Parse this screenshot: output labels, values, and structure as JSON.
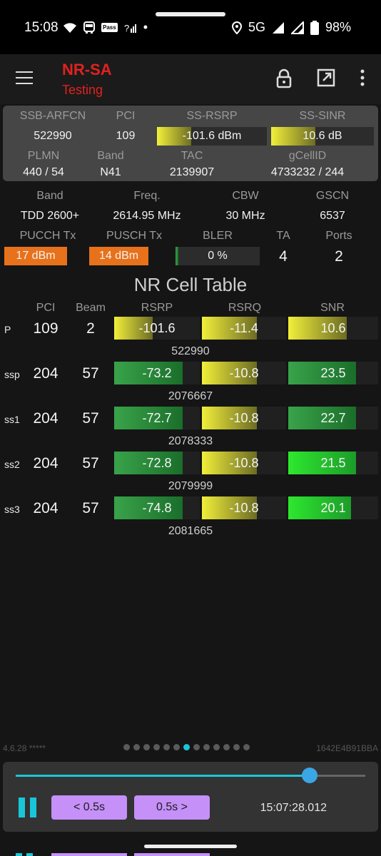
{
  "status_bar": {
    "time": "15:08",
    "left_icons": [
      "wifi-icon",
      "bus-icon",
      "pass-icon",
      "call-signal-icon",
      "dot-icon"
    ],
    "pass_label": "Pass",
    "network": "5G",
    "battery": "98%",
    "right_icons": [
      "location-icon",
      "signal-icon",
      "signal-alt-icon",
      "battery-icon"
    ]
  },
  "app_bar": {
    "title": "NR-SA",
    "subtitle": "Testing",
    "title_color": "#e0221f",
    "actions": [
      "lock-icon",
      "open-external-icon",
      "more-vert-icon"
    ]
  },
  "summary": {
    "row1": {
      "ssb_arfcn_label": "SSB-ARFCN",
      "ssb_arfcn": "522990",
      "pci_label": "PCI",
      "pci": "109",
      "ss_rsrp_label": "SS-RSRP",
      "ss_rsrp": "-101.6 dBm",
      "ss_rsrp_level": 0.31,
      "ss_sinr_label": "SS-SINR",
      "ss_sinr": "10.6 dB",
      "ss_sinr_level": 0.43
    },
    "row2": {
      "plmn_label": "PLMN",
      "plmn": "440 / 54",
      "band_label": "Band",
      "band": "N41",
      "tac_label": "TAC",
      "tac": "2139907",
      "gcellid_label": "gCellID",
      "gcellid": "4733232 / 244"
    }
  },
  "details": {
    "band_label": "Band",
    "band": "TDD 2600+",
    "freq_label": "Freq.",
    "freq": "2614.95 MHz",
    "cbw_label": "CBW",
    "cbw": "30 MHz",
    "gscn_label": "GSCN",
    "gscn": "6537",
    "pucch_label": "PUCCH Tx",
    "pucch": "17 dBm",
    "pucch_level": 1.0,
    "pusch_label": "PUSCH Tx",
    "pusch": "14 dBm",
    "pusch_level": 1.0,
    "bler_label": "BLER",
    "bler": "0 %",
    "bler_level": 0.03,
    "ta_label": "TA",
    "ta": "4",
    "ports_label": "Ports",
    "ports": "2",
    "tx_color": "#e8711b"
  },
  "cell_table": {
    "title": "NR Cell Table",
    "headers": {
      "pci": "PCI",
      "beam": "Beam",
      "rsrp": "RSRP",
      "rsrq": "RSRQ",
      "snr": "SNR"
    },
    "rows": [
      {
        "label": "P",
        "pci": "109",
        "beam": "2",
        "rsrp": "-101.6",
        "rsrp_level": 0.45,
        "rsrq": "-11.4",
        "rsrq_level": 0.65,
        "snr": "10.6",
        "snr_level": 0.65,
        "arfcn": "522990"
      },
      {
        "label": "ssp",
        "pci": "204",
        "beam": "57",
        "rsrp": "-73.2",
        "rsrp_level": 0.8,
        "rsrq": "-10.8",
        "rsrq_level": 0.65,
        "snr": "23.5",
        "snr_level": 0.75,
        "arfcn": "2076667"
      },
      {
        "label": "ss1",
        "pci": "204",
        "beam": "57",
        "rsrp": "-72.7",
        "rsrp_level": 0.8,
        "rsrq": "-10.8",
        "rsrq_level": 0.65,
        "snr": "22.7",
        "snr_level": 0.75,
        "arfcn": "2078333"
      },
      {
        "label": "ss2",
        "pci": "204",
        "beam": "57",
        "rsrp": "-72.8",
        "rsrp_level": 0.8,
        "rsrq": "-10.8",
        "rsrq_level": 0.65,
        "snr": "21.5",
        "snr_level": 0.75,
        "arfcn": "2079999"
      },
      {
        "label": "ss3",
        "pci": "204",
        "beam": "57",
        "rsrp": "-74.8",
        "rsrp_level": 0.8,
        "rsrq": "-10.8",
        "rsrq_level": 0.65,
        "snr": "20.1",
        "snr_level": 0.7,
        "arfcn": "2081665"
      }
    ]
  },
  "footer": {
    "version": "4.6.28 *****",
    "device_id": "1642E4B91BBA",
    "page_count": 13,
    "active_page": 7
  },
  "player": {
    "position": 0.84,
    "back_label": "< 0.5s",
    "forward_label": "0.5s >",
    "timestamp": "15:07:28.012",
    "accent_color": "#19c6d9",
    "button_color": "#c590f8"
  }
}
